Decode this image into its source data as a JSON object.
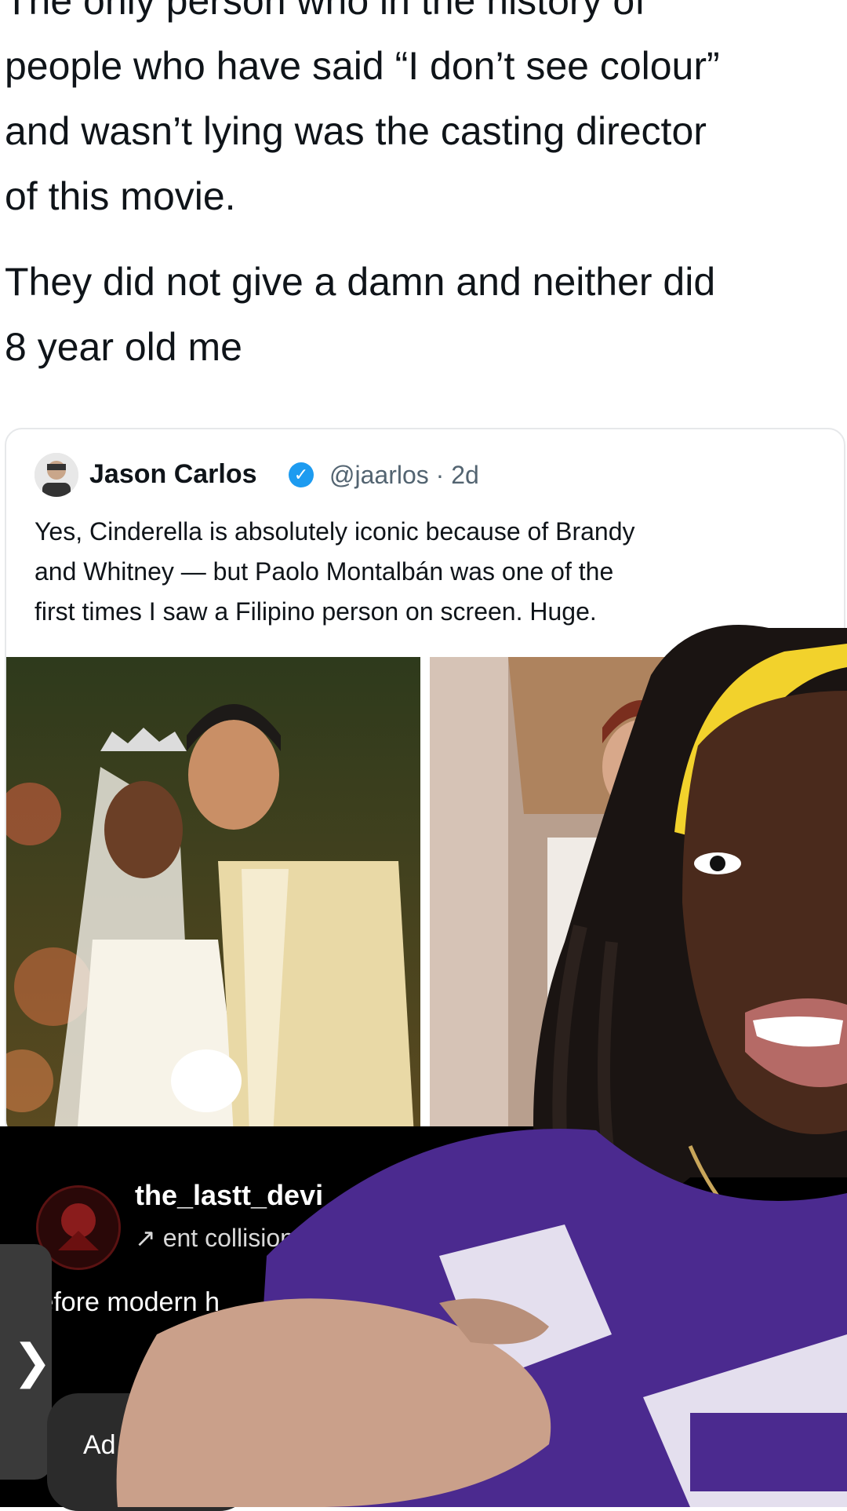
{
  "tweet": {
    "lines": [
      "The only person who in the history of",
      "people who have said “I don’t see colour”",
      "and wasn’t lying was the casting director",
      "of this movie.",
      "They did not give a damn and neither did",
      "8 year old me"
    ]
  },
  "quote": {
    "name": "Jason Carlos",
    "handle": "@jaarlos · 2d",
    "text_lines": [
      "Yes, Cinderella is absolutely iconic because of Brandy",
      "and Whitney — but Paolo Montalbán was one of the",
      "first times I saw a Filipino person on screen. Huge."
    ]
  },
  "overlay": {
    "account_name": "the_lastt_devi",
    "account_sub": "↗ ent collision",
    "caption": "ıefore modern h",
    "side_arrow": "❯",
    "add_label": "Ad"
  },
  "icons": {
    "like": "heart-icon",
    "verified": "verified-badge-icon"
  },
  "colors": {
    "shirt": "#4b2a8f",
    "headband": "#f2d22c",
    "verified": "#1d9bf0"
  }
}
